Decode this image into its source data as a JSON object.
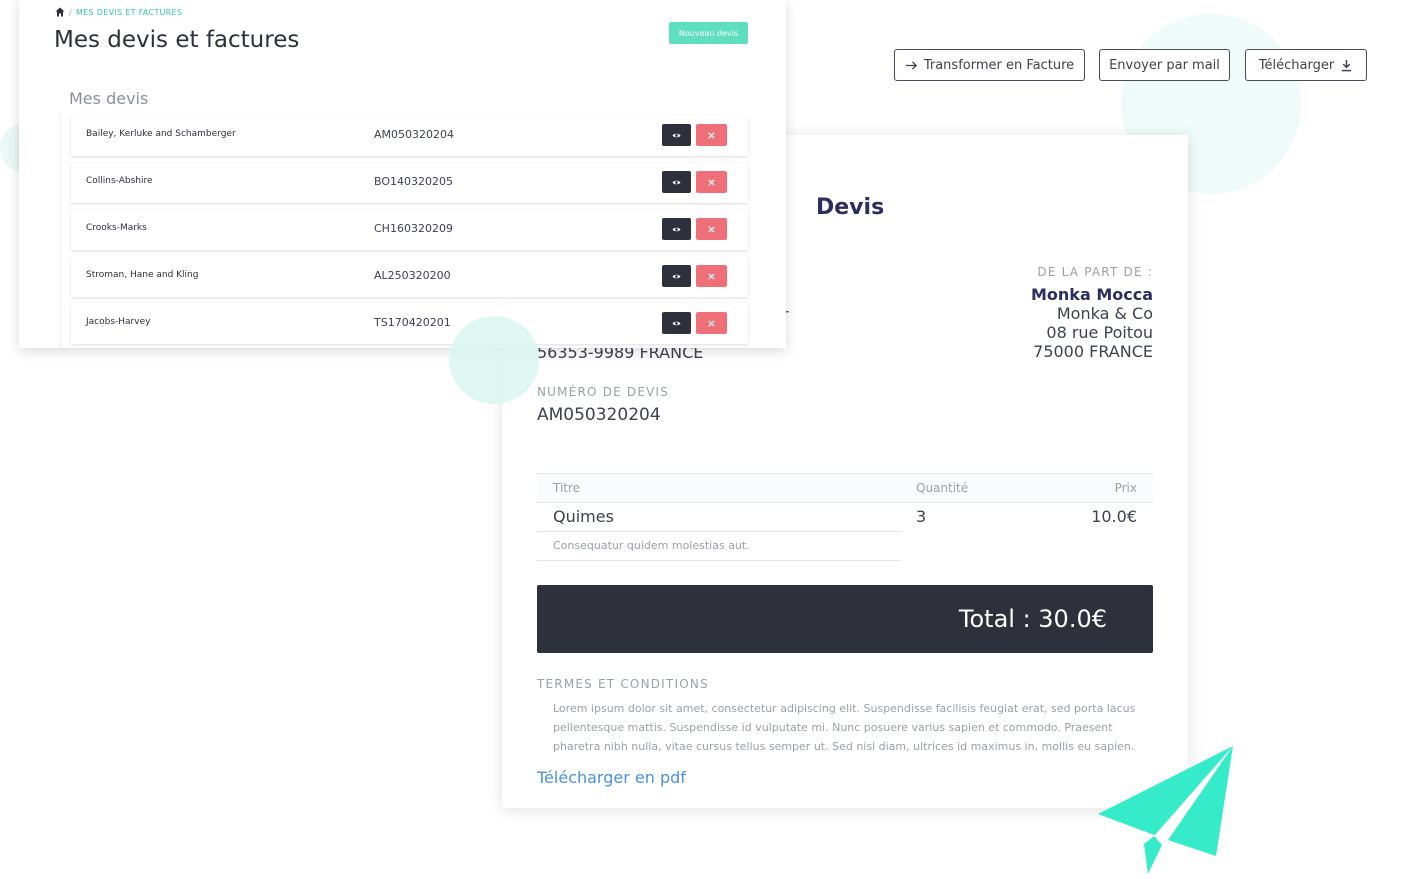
{
  "colors": {
    "accent": "#5ee0c0",
    "dark": "#2e303c",
    "danger": "#ee6f78",
    "link": "#4a90e2",
    "plane": "#35ebc9"
  },
  "breadcrumb": {
    "home_icon": "home-icon",
    "current": "MES DEVIS ET FACTURES"
  },
  "header": {
    "title": "Mes devis et factures",
    "new_button": "Nouveau devis"
  },
  "quotes": {
    "section_title": "Mes devis",
    "view_icon": "eye-icon",
    "delete_icon": "close-icon",
    "rows": [
      {
        "client": "Bailey, Kerluke and Schamberger",
        "number": "AM050320204"
      },
      {
        "client": "Collins-Abshire",
        "number": "BO140320205"
      },
      {
        "client": "Crooks-Marks",
        "number": "CH160320209"
      },
      {
        "client": "Stroman, Hane and Kling",
        "number": "AL250320200"
      },
      {
        "client": "Jacobs-Harvey",
        "number": "TS170420201"
      }
    ]
  },
  "actions": {
    "transform": "Transformer en Facture",
    "transform_icon": "arrow-right-icon",
    "send": "Envoyer par mail",
    "download": "Télécharger",
    "download_icon": "download-icon"
  },
  "document": {
    "title": "Devis",
    "from_label": "DE LA PART DE :",
    "from_name": "Monka Mocca",
    "from_company": "Monka & Co",
    "from_street": "08 rue Poitou",
    "from_city": "75000 FRANCE",
    "client_fragment": "r",
    "client_country": "56353-9989 FRANCE",
    "number_label": "NUMÉRO DE DEVIS",
    "number": "AM050320204",
    "items_header": {
      "title": "Titre",
      "quantity": "Quantité",
      "price": "Prix"
    },
    "items": [
      {
        "title": "Quimes",
        "quantity": "3",
        "price": "10.0€",
        "description": "Consequatur quidem molestias aut."
      }
    ],
    "total": "Total : 30.0€",
    "terms_label": "TERMES ET CONDITIONS",
    "terms_text": "Lorem ipsum dolor sit amet, consectetur adipiscing elit. Suspendisse facilisis feugiat erat, sed porta lacus pellentesque mattis. Suspendisse id vulputate mi. Nunc posuere varius sapien et commodo. Praesent pharetra nibh nulla, vitae cursus tellus semper ut. Sed nisl diam, ultrices id maximus in, mollis eu sapien.",
    "pdf_link": "Télécharger en pdf"
  },
  "decoration": {
    "plane_icon": "paper-plane-icon"
  }
}
